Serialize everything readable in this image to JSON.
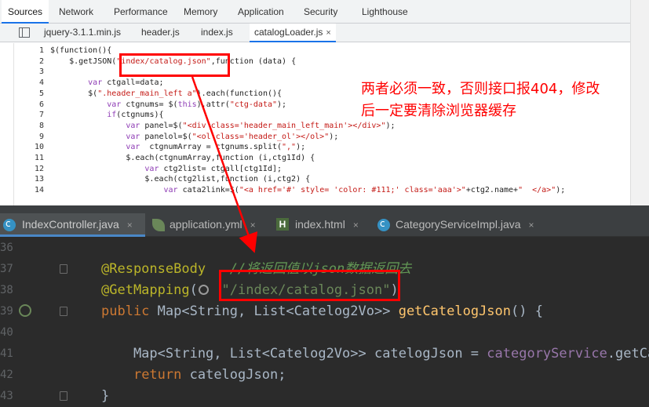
{
  "devtools": {
    "tabs": [
      "Sources",
      "Network",
      "Performance",
      "Memory",
      "Application",
      "Security",
      "Lighthouse"
    ],
    "active_tab": "Sources",
    "files": [
      "jquery-3.1.1.min.js",
      "header.js",
      "index.js",
      "catalogLoader.js"
    ],
    "active_file": "catalogLoader.js",
    "close_glyph": "×",
    "lines": [
      {
        "n": "1",
        "parts": [
          [
            "",
            "$(function(){"
          ]
        ]
      },
      {
        "n": "2",
        "parts": [
          [
            "",
            "    $.getJSON("
          ],
          [
            "str",
            "\"index/catalog.json\""
          ],
          [
            "",
            ",function (data) {"
          ]
        ]
      },
      {
        "n": "3",
        "parts": [
          [
            "",
            ""
          ]
        ]
      },
      {
        "n": "4",
        "parts": [
          [
            "kw",
            "        var"
          ],
          [
            "",
            " ctgall=data;"
          ]
        ]
      },
      {
        "n": "5",
        "parts": [
          [
            "",
            "        $("
          ],
          [
            "str",
            "\".header_main_left a\""
          ],
          [
            "",
            ").each(function(){"
          ]
        ]
      },
      {
        "n": "6",
        "parts": [
          [
            "kw",
            "            var"
          ],
          [
            "",
            " ctgnums= $("
          ],
          [
            "kw",
            "this"
          ],
          [
            "",
            ").attr("
          ],
          [
            "str",
            "\"ctg-data\""
          ],
          [
            "",
            ");"
          ]
        ]
      },
      {
        "n": "7",
        "parts": [
          [
            "kw",
            "            if"
          ],
          [
            "",
            "(ctgnums){"
          ]
        ]
      },
      {
        "n": "8",
        "parts": [
          [
            "kw",
            "                var"
          ],
          [
            "",
            " panel=$("
          ],
          [
            "str",
            "\"<div class='header_main_left_main'></div>\""
          ],
          [
            "",
            ");"
          ]
        ]
      },
      {
        "n": "9",
        "parts": [
          [
            "kw",
            "                var"
          ],
          [
            "",
            " panelol=$("
          ],
          [
            "str",
            "\"<ol class='header_ol'></ol>\""
          ],
          [
            "",
            ");"
          ]
        ]
      },
      {
        "n": "10",
        "parts": [
          [
            "kw",
            "                var"
          ],
          [
            "",
            "  ctgnumArray = ctgnums.split("
          ],
          [
            "str",
            "\",\""
          ],
          [
            "",
            ");"
          ]
        ]
      },
      {
        "n": "11",
        "parts": [
          [
            "",
            "                $.each(ctgnumArray,function (i,ctg1Id) {"
          ]
        ]
      },
      {
        "n": "12",
        "parts": [
          [
            "kw",
            "                    var"
          ],
          [
            "",
            " ctg2list= ctgall[ctg1Id];"
          ]
        ]
      },
      {
        "n": "13",
        "parts": [
          [
            "",
            "                    $.each(ctg2list,function (i,ctg2) {"
          ]
        ]
      },
      {
        "n": "14",
        "parts": [
          [
            "kw",
            "                        var"
          ],
          [
            "",
            " cata2link=$("
          ],
          [
            "str",
            "\"<a href='#' style= 'color: #111;' class='aaa'>\""
          ],
          [
            "",
            "+ctg2.name+"
          ],
          [
            "str",
            "\"  </a>\""
          ],
          [
            "",
            ");"
          ]
        ]
      }
    ]
  },
  "annotation": {
    "text_line1": "两者必须一致，否则接口报404，修改",
    "text_line2": "后一定要清除浏览器缓存",
    "color": "#ff0000"
  },
  "ide": {
    "tabs": [
      {
        "label": "IndexController.java",
        "icon": "java-class-icon"
      },
      {
        "label": "application.yml",
        "icon": "spring-config-icon"
      },
      {
        "label": "index.html",
        "icon": "html-file-icon"
      },
      {
        "label": "CategoryServiceImpl.java",
        "icon": "java-class-icon"
      }
    ],
    "close_glyph": "×",
    "lines": [
      {
        "n": "36",
        "parts": []
      },
      {
        "n": "37",
        "parts": [
          [
            "ann",
            "@ResponseBody"
          ],
          [
            "",
            "   "
          ],
          [
            "cmt",
            "//将返回值以json数据返回去"
          ]
        ]
      },
      {
        "n": "38",
        "parts": [
          [
            "ann",
            "@GetMapping"
          ],
          [
            "",
            "(   "
          ],
          [
            "str",
            "\"/index/catalog.json\""
          ],
          [
            "",
            ")"
          ]
        ]
      },
      {
        "n": "39",
        "parts": [
          [
            "kw",
            "public"
          ],
          [
            "",
            " Map<String, List<Catelog2Vo>> "
          ],
          [
            "fn",
            "getCatelogJson"
          ],
          [
            "",
            "() {"
          ]
        ]
      },
      {
        "n": "40",
        "parts": []
      },
      {
        "n": "41",
        "parts": [
          [
            "",
            "    Map<String, List<Catelog2Vo>> catelogJson = "
          ],
          [
            "field",
            "categoryService"
          ],
          [
            "",
            ".getCat"
          ]
        ]
      },
      {
        "n": "42",
        "parts": [
          [
            "",
            "    "
          ],
          [
            "kw",
            "return"
          ],
          [
            "",
            " catelogJson;"
          ]
        ]
      },
      {
        "n": "43",
        "parts": [
          [
            "",
            "}"
          ]
        ]
      }
    ]
  },
  "colors": {
    "highlight_red": "#ff0000",
    "ide_background": "#2b2b2b",
    "devtools_background": "#ffffff"
  }
}
